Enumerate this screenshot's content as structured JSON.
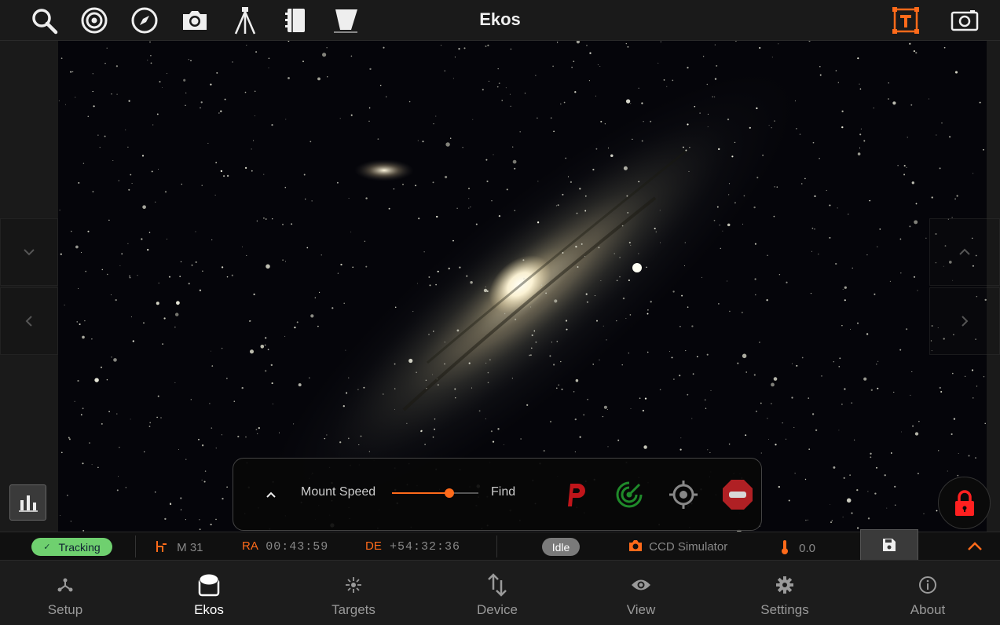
{
  "app": {
    "title": "Ekos"
  },
  "topbar": {
    "left_icons": [
      "search-icon",
      "target-icon",
      "compass-icon",
      "camera-icon",
      "tripod-icon",
      "notebook-icon",
      "flat-panel-icon"
    ],
    "right_icons": [
      "text-overlay-icon",
      "screenshot-icon"
    ]
  },
  "mount_panel": {
    "speed_label": "Mount Speed",
    "speed_value_label": "Find",
    "speed_level": 0.66,
    "buttons": [
      "park-icon",
      "tracking-radar-icon",
      "sync-center-icon",
      "abort-icon"
    ]
  },
  "status": {
    "tracking_label": "Tracking",
    "target": "M 31",
    "ra_label": "RA",
    "ra_value": "00:43:59",
    "de_label": "DE",
    "de_value": "+54:32:36",
    "idle_label": "Idle",
    "camera": "CCD Simulator",
    "temperature": "0.0"
  },
  "nav": [
    {
      "label": "Setup",
      "icon": "setup-icon"
    },
    {
      "label": "Ekos",
      "icon": "ekos-icon",
      "active": true
    },
    {
      "label": "Targets",
      "icon": "targets-icon"
    },
    {
      "label": "Device",
      "icon": "device-icon"
    },
    {
      "label": "View",
      "icon": "view-icon"
    },
    {
      "label": "Settings",
      "icon": "settings-icon"
    },
    {
      "label": "About",
      "icon": "about-icon"
    }
  ],
  "colors": {
    "accent": "#ff6a1a",
    "tracking_green": "#6fd06f",
    "park_red": "#c0151a",
    "radar_green": "#1f8a2a",
    "abort_red": "#b02024",
    "lock_red": "#ff2020"
  }
}
